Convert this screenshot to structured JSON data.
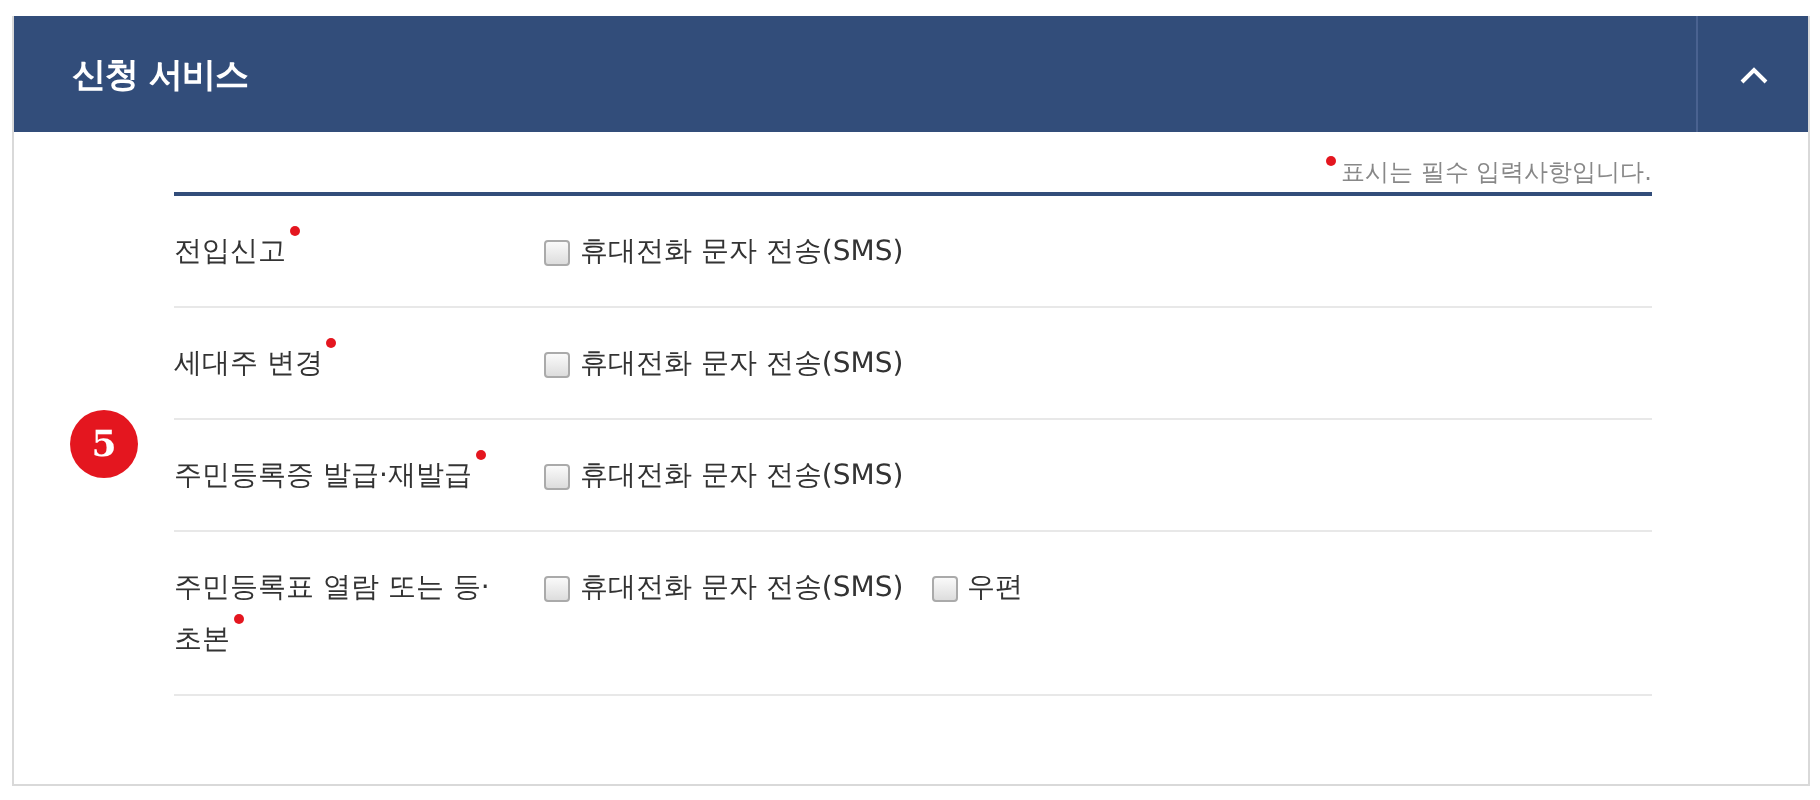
{
  "panel": {
    "title": "신청 서비스",
    "expanded": true
  },
  "note": "표시는 필수 입력사항입니다.",
  "step_badge": "5",
  "rows": [
    {
      "label": "전입신고",
      "required": true,
      "options": [
        {
          "label": "휴대전화 문자 전송(SMS)",
          "checked": false
        }
      ]
    },
    {
      "label": "세대주 변경",
      "required": true,
      "options": [
        {
          "label": "휴대전화 문자 전송(SMS)",
          "checked": false
        }
      ]
    },
    {
      "label": "주민등록증 발급·재발급",
      "required": true,
      "options": [
        {
          "label": "휴대전화 문자 전송(SMS)",
          "checked": false
        }
      ]
    },
    {
      "label": "주민등록표 열람 또는 등·초본",
      "required": true,
      "options": [
        {
          "label": "휴대전화 문자 전송(SMS)",
          "checked": false
        },
        {
          "label": "우편",
          "checked": false
        }
      ]
    }
  ]
}
